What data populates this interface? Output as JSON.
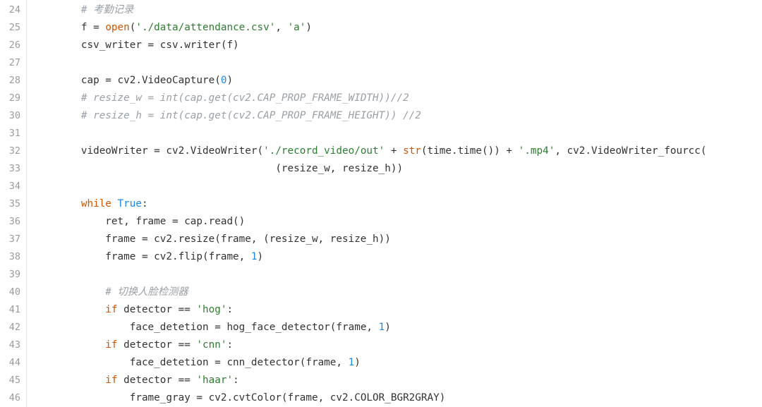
{
  "gutter": {
    "start": 24,
    "end": 46
  },
  "code": {
    "indent_unit": "    ",
    "lines": [
      {
        "n": 24,
        "indent": 2,
        "tokens": [
          {
            "t": "# 考勤记录",
            "c": "comment"
          }
        ]
      },
      {
        "n": 25,
        "indent": 2,
        "tokens": [
          {
            "t": "f = "
          },
          {
            "t": "open",
            "c": "builtin"
          },
          {
            "t": "("
          },
          {
            "t": "'./data/attendance.csv'",
            "c": "str"
          },
          {
            "t": ", "
          },
          {
            "t": "'a'",
            "c": "str"
          },
          {
            "t": ")"
          }
        ]
      },
      {
        "n": 26,
        "indent": 2,
        "tokens": [
          {
            "t": "csv_writer = csv.writer(f)"
          }
        ]
      },
      {
        "n": 27,
        "indent": 0,
        "tokens": []
      },
      {
        "n": 28,
        "indent": 2,
        "tokens": [
          {
            "t": "cap = cv2.VideoCapture("
          },
          {
            "t": "0",
            "c": "num"
          },
          {
            "t": ")"
          }
        ]
      },
      {
        "n": 29,
        "indent": 2,
        "tokens": [
          {
            "t": "# resize_w = int(cap.get(cv2.CAP_PROP_FRAME_WIDTH))//2",
            "c": "comment"
          }
        ]
      },
      {
        "n": 30,
        "indent": 2,
        "tokens": [
          {
            "t": "# resize_h = int(cap.get(cv2.CAP_PROP_FRAME_HEIGHT)) //2",
            "c": "comment"
          }
        ]
      },
      {
        "n": 31,
        "indent": 0,
        "tokens": []
      },
      {
        "n": 32,
        "indent": 2,
        "tokens": [
          {
            "t": "videoWriter = cv2.VideoWriter("
          },
          {
            "t": "'./record_video/out'",
            "c": "str"
          },
          {
            "t": " + "
          },
          {
            "t": "str",
            "c": "builtin"
          },
          {
            "t": "(time.time()) + "
          },
          {
            "t": "'.mp4'",
            "c": "str"
          },
          {
            "t": ", cv2.VideoWriter_fourcc("
          }
        ]
      },
      {
        "n": 33,
        "indent": 0,
        "pad_spaces": 40,
        "tokens": [
          {
            "t": "(resize_w, resize_h))"
          }
        ]
      },
      {
        "n": 34,
        "indent": 0,
        "tokens": []
      },
      {
        "n": 35,
        "indent": 2,
        "tokens": [
          {
            "t": "while",
            "c": "kw"
          },
          {
            "t": " "
          },
          {
            "t": "True",
            "c": "const"
          },
          {
            "t": ":"
          }
        ]
      },
      {
        "n": 36,
        "indent": 3,
        "tokens": [
          {
            "t": "ret, frame = cap.read()"
          }
        ]
      },
      {
        "n": 37,
        "indent": 3,
        "tokens": [
          {
            "t": "frame = cv2.resize(frame, (resize_w, resize_h))"
          }
        ]
      },
      {
        "n": 38,
        "indent": 3,
        "tokens": [
          {
            "t": "frame = cv2.flip(frame, "
          },
          {
            "t": "1",
            "c": "num"
          },
          {
            "t": ")"
          }
        ]
      },
      {
        "n": 39,
        "indent": 0,
        "tokens": []
      },
      {
        "n": 40,
        "indent": 3,
        "tokens": [
          {
            "t": "# 切换人脸检测器",
            "c": "comment"
          }
        ]
      },
      {
        "n": 41,
        "indent": 3,
        "tokens": [
          {
            "t": "if",
            "c": "kw"
          },
          {
            "t": " detector == "
          },
          {
            "t": "'hog'",
            "c": "str"
          },
          {
            "t": ":"
          }
        ]
      },
      {
        "n": 42,
        "indent": 4,
        "tokens": [
          {
            "t": "face_detetion = hog_face_detector(frame, "
          },
          {
            "t": "1",
            "c": "num"
          },
          {
            "t": ")"
          }
        ]
      },
      {
        "n": 43,
        "indent": 3,
        "tokens": [
          {
            "t": "if",
            "c": "kw"
          },
          {
            "t": " detector == "
          },
          {
            "t": "'cnn'",
            "c": "str"
          },
          {
            "t": ":"
          }
        ]
      },
      {
        "n": 44,
        "indent": 4,
        "tokens": [
          {
            "t": "face_detetion = cnn_detector(frame, "
          },
          {
            "t": "1",
            "c": "num"
          },
          {
            "t": ")"
          }
        ]
      },
      {
        "n": 45,
        "indent": 3,
        "tokens": [
          {
            "t": "if",
            "c": "kw"
          },
          {
            "t": " detector == "
          },
          {
            "t": "'haar'",
            "c": "str"
          },
          {
            "t": ":"
          }
        ]
      },
      {
        "n": 46,
        "indent": 4,
        "tokens": [
          {
            "t": "frame_gray = cv2.cvtColor(frame, cv2.COLOR_BGR2GRAY)"
          }
        ]
      }
    ]
  }
}
